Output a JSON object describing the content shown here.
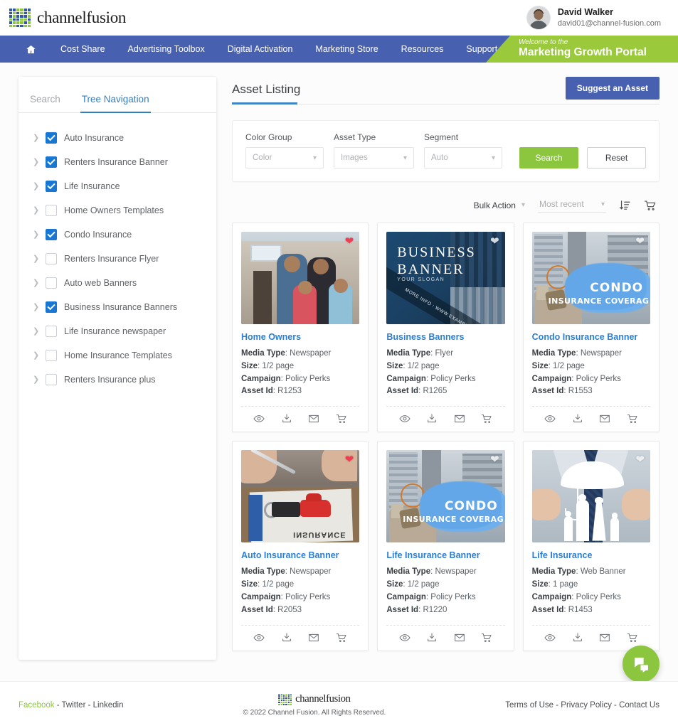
{
  "brand": {
    "name": "channelfusion",
    "logo_colors": [
      "#2e58a6",
      "#8cc63e"
    ]
  },
  "header": {
    "user": {
      "name": "David Walker",
      "email": "david01@channel-fusion.com",
      "avatar_icon": "user-avatar"
    }
  },
  "nav": {
    "home_icon": "home-icon",
    "items": [
      {
        "label": "Cost Share"
      },
      {
        "label": "Advertising Toolbox"
      },
      {
        "label": "Digital Activation"
      },
      {
        "label": "Marketing Store"
      },
      {
        "label": "Resources"
      },
      {
        "label": "Support"
      }
    ],
    "banner": {
      "line1": "Welcome to the",
      "line2": "Marketing Growth Portal",
      "color": "#9ac93c"
    }
  },
  "sidebar": {
    "tabs": [
      {
        "label": "Search",
        "active": false
      },
      {
        "label": "Tree Navigation",
        "active": true
      }
    ],
    "tree": [
      {
        "label": "Auto Insurance",
        "checked": true
      },
      {
        "label": "Renters Insurance Banner",
        "checked": true
      },
      {
        "label": "Life Insurance",
        "checked": true
      },
      {
        "label": "Home Owners Templates",
        "checked": false
      },
      {
        "label": "Condo Insurance",
        "checked": true
      },
      {
        "label": "Renters Insurance Flyer",
        "checked": false
      },
      {
        "label": "Auto web Banners",
        "checked": false
      },
      {
        "label": "Business Insurance Banners",
        "checked": true
      },
      {
        "label": "Life Insurance newspaper",
        "checked": false
      },
      {
        "label": "Home Insurance Templates",
        "checked": false
      },
      {
        "label": "Renters Insurance plus",
        "checked": false
      }
    ]
  },
  "main": {
    "title": "Asset Listing",
    "suggest_button": "Suggest an Asset",
    "filters": {
      "fields": [
        {
          "label": "Color Group",
          "value": "Color"
        },
        {
          "label": "Asset Type",
          "value": "Images"
        },
        {
          "label": "Segment",
          "value": "Auto"
        }
      ],
      "search_button": "Search",
      "reset_button": "Reset",
      "search_color": "#8cc63e"
    },
    "toolbar": {
      "bulk_action": "Bulk Action",
      "sort_value": "Most recent",
      "sort_icon": "sort-descending-icon",
      "cart_icon": "cart-icon"
    },
    "card_labels": {
      "media_type": "Media Type",
      "size": "Size",
      "campaign": "Campaign",
      "asset_id": "Asset Id"
    },
    "card_actions": [
      "preview-icon",
      "download-icon",
      "email-icon",
      "cart-icon"
    ],
    "cards": [
      {
        "title": "Home Owners",
        "media_type": "Newspaper",
        "size": "1/2 page",
        "campaign": "Policy Perks",
        "asset_id": "R1253",
        "favorite": true,
        "art": "home-family-photo"
      },
      {
        "title": "Business Banners",
        "media_type": "Flyer",
        "size": "1/2 page",
        "campaign": "Policy Perks",
        "asset_id": "R1265",
        "favorite": false,
        "art": "business-banner-graphic",
        "art_text": {
          "t1": "BUSINESS\nBANNER",
          "t2": "YOUR SLOGAN",
          "band": "MORE INFO : WWW.EXAMPLE.COM"
        }
      },
      {
        "title": "Condo Insurance Banner",
        "media_type": "Newspaper",
        "size": "1/2 page",
        "campaign": "Policy Perks",
        "asset_id": "R1553",
        "favorite": false,
        "art": "condo-interior-photo",
        "art_text": {
          "t1": "CONDO",
          "t2": "INSURANCE COVERAG"
        }
      },
      {
        "title": "Auto Insurance Banner",
        "media_type": "Newspaper",
        "size": "1/2 page",
        "campaign": "Policy Perks",
        "asset_id": "R2053",
        "favorite": true,
        "art": "auto-keys-photo",
        "art_text": {
          "t1": "INSURANCE"
        }
      },
      {
        "title": "Life Insurance Banner",
        "media_type": "Newspaper",
        "size": "1/2 page",
        "campaign": "Policy Perks",
        "asset_id": "R1220",
        "favorite": false,
        "art": "condo-interior-photo",
        "art_text": {
          "t1": "CONDO",
          "t2": "INSURANCE COVERAG"
        }
      },
      {
        "title": "Life Insurance",
        "media_type": "Web Banner",
        "size": "1 page",
        "campaign": "Policy Perks",
        "asset_id": "R1453",
        "favorite": false,
        "art": "umbrella-family-photo"
      }
    ]
  },
  "footer": {
    "social": [
      {
        "label": "Facebook",
        "accent": true
      },
      {
        "label": "Twitter",
        "accent": false
      },
      {
        "label": "Linkedin",
        "accent": false
      }
    ],
    "separator": "-",
    "brand": "channelfusion",
    "copyright": "© 2022 Channel Fusion. All Rights Reserved.",
    "links": [
      {
        "label": "Terms of Use"
      },
      {
        "label": "Privacy Policy"
      },
      {
        "label": "Contact Us"
      }
    ],
    "chat_icon": "chat-bubbles-icon"
  }
}
